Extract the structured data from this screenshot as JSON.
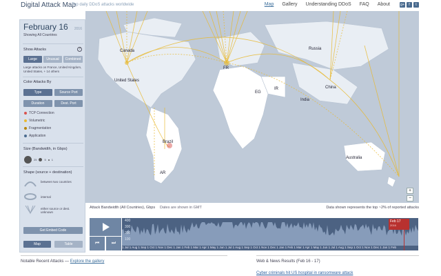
{
  "header": {
    "title": "Digital Attack Map",
    "subtitle": "Top daily DDoS attacks worldwide",
    "nav": [
      "Map",
      "Gallery",
      "Understanding DDoS",
      "FAQ",
      "About"
    ],
    "social": [
      "g+",
      "f",
      "t"
    ]
  },
  "panel": {
    "date": "February 16",
    "year": "2016",
    "showing": "Showing All Countries",
    "show_attacks": "Show Attacks",
    "help": "?",
    "show_buttons": [
      "Large",
      "Unusual",
      "Combined"
    ],
    "large_note_1": "Large attacks on France, United Kingdom,",
    "large_note_2": "United States, + 14 others",
    "color_by": "Color Attacks By",
    "color_buttons": [
      "Type",
      "Source Port",
      "Duration",
      "Dest. Port"
    ],
    "legend": [
      {
        "label": "TCP Connection",
        "color": "#d9534f"
      },
      {
        "label": "Volumetric",
        "color": "#e8b930"
      },
      {
        "label": "Fragmentation",
        "color": "#b8860b"
      },
      {
        "label": "Application",
        "color": "#4a6b8f"
      }
    ],
    "size_label": "Size (Bandwidth, in Gbps)",
    "size_values": [
      "25",
      "5",
      "1"
    ],
    "shape_label": "Shape (source + destination)",
    "shapes": [
      {
        "label": "between two countries"
      },
      {
        "label": "internal"
      },
      {
        "label": "either source or dest. unknown"
      }
    ],
    "embed": "Get Embed Code",
    "views": [
      "Map",
      "Table"
    ]
  },
  "map": {
    "labels": [
      "Canada",
      "United States",
      "Russia",
      "China",
      "India",
      "EG",
      "IR",
      "Brazil",
      "AR",
      "Australia",
      "FR"
    ],
    "zoom_in": "+",
    "zoom_out": "−"
  },
  "timeline": {
    "title": "Attack Bandwidth (All Countries), Gbps",
    "note": "Dates are shown in GMT",
    "right_note": "Data shown represents the top ~2% of reported attacks",
    "yticks": [
      "400",
      "300",
      "200",
      "100"
    ],
    "xaxis": "1 Jul 1 Aug 1 Sep 1 Oct 1 Nov 1 Dec 1 Jan 1 Feb 1 Mar 1 Apr 1 May 1 Jun 1 Jul 1 Aug 1 Sep 1 Oct 1 Nov 1 Dec 1 Jan 1 Feb 1 Mar 1 Apr 1 May 1 Jun 1 Jul 1 Aug 1 Sep 1 Oct 1 Nov 1 Dec 1 Jan 1 Feb",
    "tag_date": "Feb 17",
    "tag_year": "2016",
    "skip_back": "⏮",
    "skip_forward": "⏭"
  },
  "footer": {
    "recent": "Notable Recent Attacks —",
    "gallery_link": "Explore the gallery",
    "news": "Web & News Results (Feb 16 - 17)",
    "news_link": "Cyber criminals hit US hospital in ransomware attack"
  },
  "colors": {
    "panel": "#d9e1ec",
    "ocean": "#bfcad8",
    "land": "#ffffff",
    "attack": "#e8b930",
    "chart": "#4c6282"
  }
}
